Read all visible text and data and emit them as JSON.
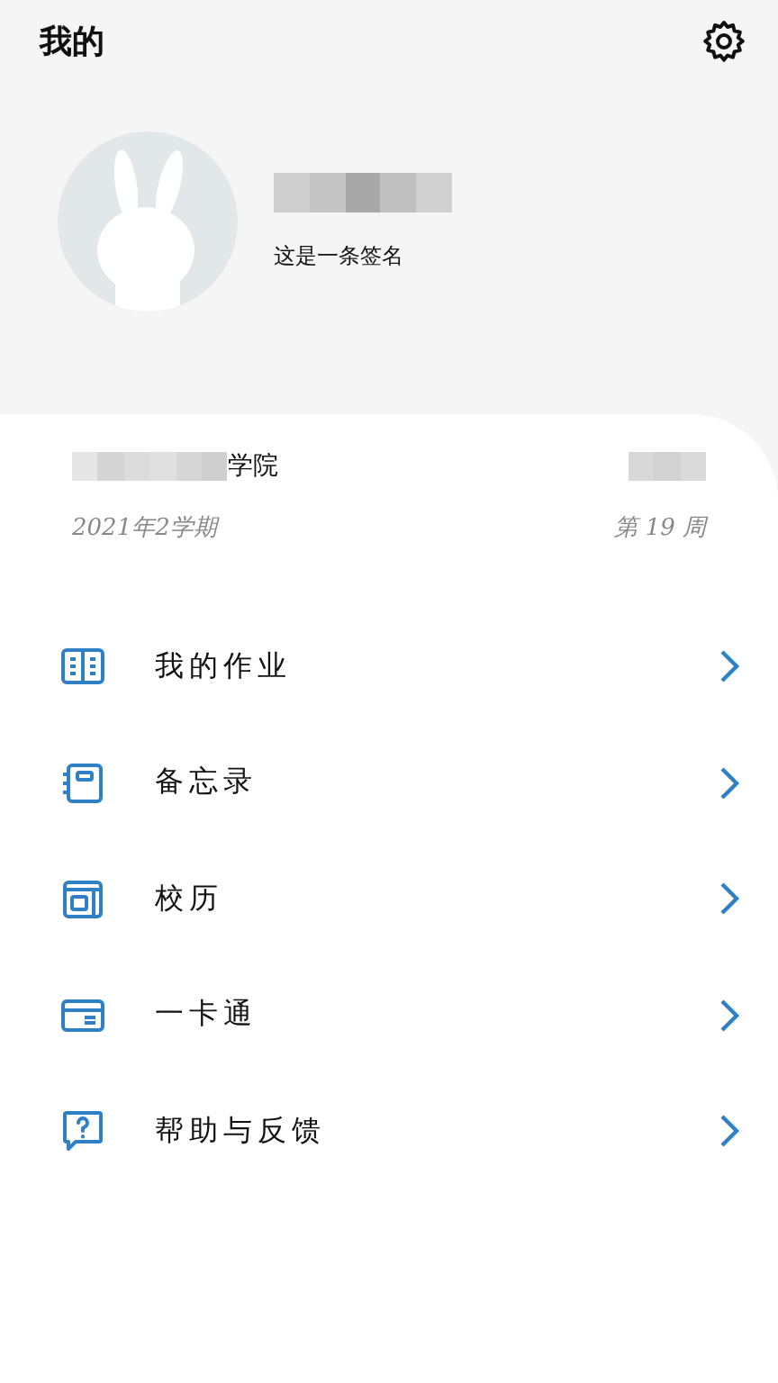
{
  "header": {
    "title": "我的"
  },
  "profile": {
    "signature": "这是一条签名"
  },
  "school": {
    "college": "学院",
    "semester": "2021年2学期",
    "week": "第 19 周"
  },
  "menu": [
    {
      "kind": "book",
      "label": "我的作业"
    },
    {
      "kind": "notebook",
      "label": "备忘录"
    },
    {
      "kind": "calendar",
      "label": "校历"
    },
    {
      "kind": "card",
      "label": "一卡通"
    },
    {
      "kind": "help",
      "label": "帮助与反馈"
    }
  ]
}
